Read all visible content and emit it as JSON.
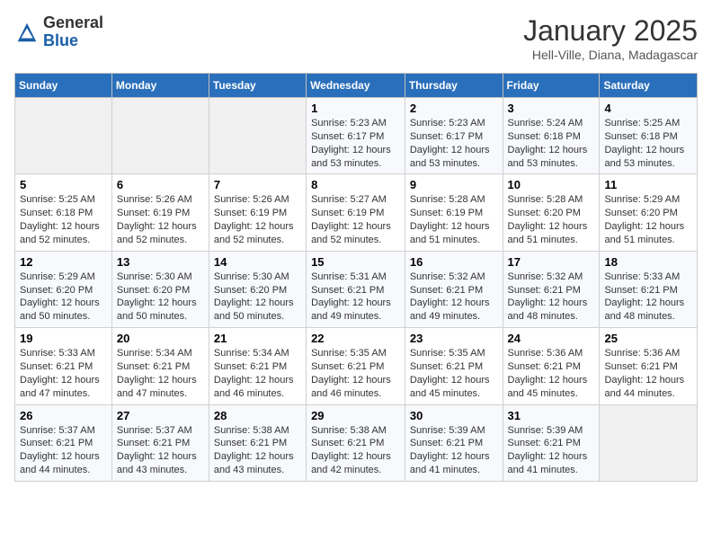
{
  "logo": {
    "general": "General",
    "blue": "Blue"
  },
  "header": {
    "month": "January 2025",
    "location": "Hell-Ville, Diana, Madagascar"
  },
  "weekdays": [
    "Sunday",
    "Monday",
    "Tuesday",
    "Wednesday",
    "Thursday",
    "Friday",
    "Saturday"
  ],
  "weeks": [
    [
      {
        "day": "",
        "sunrise": "",
        "sunset": "",
        "daylight": ""
      },
      {
        "day": "",
        "sunrise": "",
        "sunset": "",
        "daylight": ""
      },
      {
        "day": "",
        "sunrise": "",
        "sunset": "",
        "daylight": ""
      },
      {
        "day": "1",
        "sunrise": "Sunrise: 5:23 AM",
        "sunset": "Sunset: 6:17 PM",
        "daylight": "Daylight: 12 hours and 53 minutes."
      },
      {
        "day": "2",
        "sunrise": "Sunrise: 5:23 AM",
        "sunset": "Sunset: 6:17 PM",
        "daylight": "Daylight: 12 hours and 53 minutes."
      },
      {
        "day": "3",
        "sunrise": "Sunrise: 5:24 AM",
        "sunset": "Sunset: 6:18 PM",
        "daylight": "Daylight: 12 hours and 53 minutes."
      },
      {
        "day": "4",
        "sunrise": "Sunrise: 5:25 AM",
        "sunset": "Sunset: 6:18 PM",
        "daylight": "Daylight: 12 hours and 53 minutes."
      }
    ],
    [
      {
        "day": "5",
        "sunrise": "Sunrise: 5:25 AM",
        "sunset": "Sunset: 6:18 PM",
        "daylight": "Daylight: 12 hours and 52 minutes."
      },
      {
        "day": "6",
        "sunrise": "Sunrise: 5:26 AM",
        "sunset": "Sunset: 6:19 PM",
        "daylight": "Daylight: 12 hours and 52 minutes."
      },
      {
        "day": "7",
        "sunrise": "Sunrise: 5:26 AM",
        "sunset": "Sunset: 6:19 PM",
        "daylight": "Daylight: 12 hours and 52 minutes."
      },
      {
        "day": "8",
        "sunrise": "Sunrise: 5:27 AM",
        "sunset": "Sunset: 6:19 PM",
        "daylight": "Daylight: 12 hours and 52 minutes."
      },
      {
        "day": "9",
        "sunrise": "Sunrise: 5:28 AM",
        "sunset": "Sunset: 6:19 PM",
        "daylight": "Daylight: 12 hours and 51 minutes."
      },
      {
        "day": "10",
        "sunrise": "Sunrise: 5:28 AM",
        "sunset": "Sunset: 6:20 PM",
        "daylight": "Daylight: 12 hours and 51 minutes."
      },
      {
        "day": "11",
        "sunrise": "Sunrise: 5:29 AM",
        "sunset": "Sunset: 6:20 PM",
        "daylight": "Daylight: 12 hours and 51 minutes."
      }
    ],
    [
      {
        "day": "12",
        "sunrise": "Sunrise: 5:29 AM",
        "sunset": "Sunset: 6:20 PM",
        "daylight": "Daylight: 12 hours and 50 minutes."
      },
      {
        "day": "13",
        "sunrise": "Sunrise: 5:30 AM",
        "sunset": "Sunset: 6:20 PM",
        "daylight": "Daylight: 12 hours and 50 minutes."
      },
      {
        "day": "14",
        "sunrise": "Sunrise: 5:30 AM",
        "sunset": "Sunset: 6:20 PM",
        "daylight": "Daylight: 12 hours and 50 minutes."
      },
      {
        "day": "15",
        "sunrise": "Sunrise: 5:31 AM",
        "sunset": "Sunset: 6:21 PM",
        "daylight": "Daylight: 12 hours and 49 minutes."
      },
      {
        "day": "16",
        "sunrise": "Sunrise: 5:32 AM",
        "sunset": "Sunset: 6:21 PM",
        "daylight": "Daylight: 12 hours and 49 minutes."
      },
      {
        "day": "17",
        "sunrise": "Sunrise: 5:32 AM",
        "sunset": "Sunset: 6:21 PM",
        "daylight": "Daylight: 12 hours and 48 minutes."
      },
      {
        "day": "18",
        "sunrise": "Sunrise: 5:33 AM",
        "sunset": "Sunset: 6:21 PM",
        "daylight": "Daylight: 12 hours and 48 minutes."
      }
    ],
    [
      {
        "day": "19",
        "sunrise": "Sunrise: 5:33 AM",
        "sunset": "Sunset: 6:21 PM",
        "daylight": "Daylight: 12 hours and 47 minutes."
      },
      {
        "day": "20",
        "sunrise": "Sunrise: 5:34 AM",
        "sunset": "Sunset: 6:21 PM",
        "daylight": "Daylight: 12 hours and 47 minutes."
      },
      {
        "day": "21",
        "sunrise": "Sunrise: 5:34 AM",
        "sunset": "Sunset: 6:21 PM",
        "daylight": "Daylight: 12 hours and 46 minutes."
      },
      {
        "day": "22",
        "sunrise": "Sunrise: 5:35 AM",
        "sunset": "Sunset: 6:21 PM",
        "daylight": "Daylight: 12 hours and 46 minutes."
      },
      {
        "day": "23",
        "sunrise": "Sunrise: 5:35 AM",
        "sunset": "Sunset: 6:21 PM",
        "daylight": "Daylight: 12 hours and 45 minutes."
      },
      {
        "day": "24",
        "sunrise": "Sunrise: 5:36 AM",
        "sunset": "Sunset: 6:21 PM",
        "daylight": "Daylight: 12 hours and 45 minutes."
      },
      {
        "day": "25",
        "sunrise": "Sunrise: 5:36 AM",
        "sunset": "Sunset: 6:21 PM",
        "daylight": "Daylight: 12 hours and 44 minutes."
      }
    ],
    [
      {
        "day": "26",
        "sunrise": "Sunrise: 5:37 AM",
        "sunset": "Sunset: 6:21 PM",
        "daylight": "Daylight: 12 hours and 44 minutes."
      },
      {
        "day": "27",
        "sunrise": "Sunrise: 5:37 AM",
        "sunset": "Sunset: 6:21 PM",
        "daylight": "Daylight: 12 hours and 43 minutes."
      },
      {
        "day": "28",
        "sunrise": "Sunrise: 5:38 AM",
        "sunset": "Sunset: 6:21 PM",
        "daylight": "Daylight: 12 hours and 43 minutes."
      },
      {
        "day": "29",
        "sunrise": "Sunrise: 5:38 AM",
        "sunset": "Sunset: 6:21 PM",
        "daylight": "Daylight: 12 hours and 42 minutes."
      },
      {
        "day": "30",
        "sunrise": "Sunrise: 5:39 AM",
        "sunset": "Sunset: 6:21 PM",
        "daylight": "Daylight: 12 hours and 41 minutes."
      },
      {
        "day": "31",
        "sunrise": "Sunrise: 5:39 AM",
        "sunset": "Sunset: 6:21 PM",
        "daylight": "Daylight: 12 hours and 41 minutes."
      },
      {
        "day": "",
        "sunrise": "",
        "sunset": "",
        "daylight": ""
      }
    ]
  ]
}
